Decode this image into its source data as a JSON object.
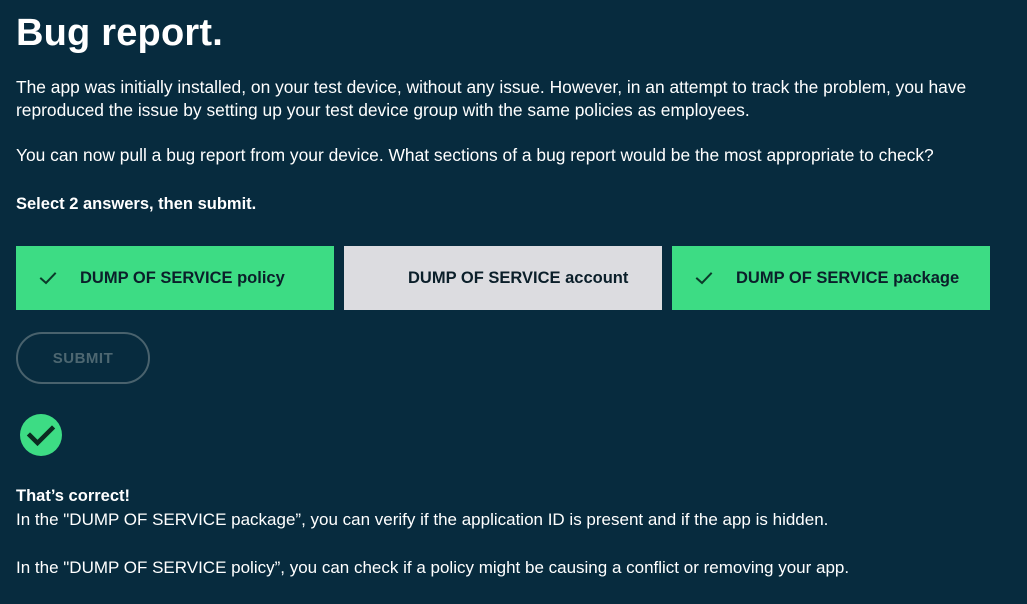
{
  "title": "Bug report.",
  "intro": "The app was initially installed, on your test device, without any issue. However, in an attempt to track the problem, you have reproduced the issue by setting up your test device group with the same policies as employees.",
  "question": "You can now pull a bug report from your device. What sections of a bug report would be the most appropriate to check?",
  "instruction": "Select 2 answers, then submit.",
  "answers": [
    {
      "label": "DUMP OF SERVICE policy",
      "selected": true,
      "icon": "check-icon"
    },
    {
      "label": "DUMP OF SERVICE account",
      "selected": false,
      "icon": ""
    },
    {
      "label": "DUMP OF SERVICE package",
      "selected": true,
      "icon": "check-icon"
    }
  ],
  "submit_label": "SUBMIT",
  "result_icon": "check-circle-icon",
  "feedback": {
    "title": "That’s correct!",
    "line1": "In the \"DUMP OF SERVICE package”, you can verify if the application ID is present and if the app is hidden.",
    "line2": "In the \"DUMP OF SERVICE policy”, you can check if a policy might be causing a conflict or removing your app."
  },
  "colors": {
    "background": "#072b3e",
    "selected": "#3ddc84",
    "unselected": "#dcdce0",
    "success": "#3ddc84",
    "submit_disabled": "#49626d"
  }
}
